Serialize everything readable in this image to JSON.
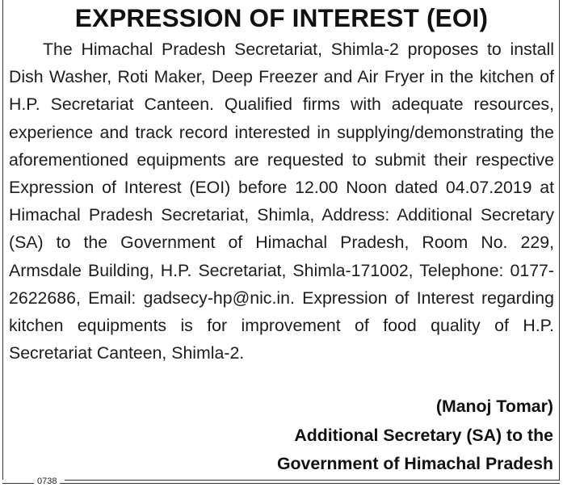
{
  "notice": {
    "title": "EXPRESSION OF INTEREST (EOI)",
    "body": "The Himachal Pradesh Secretariat, Shimla-2 proposes to install Dish Washer, Roti Maker, Deep Freezer and Air Fryer in the kitchen of H.P. Secretariat Canteen. Qualified firms with adequate resources, experience and track record interested in supplying/demonstrating the aforementioned equipments are requested to submit their respective Expression of Interest (EOI) before 12.00 Noon dated 04.07.2019 at Himachal Pradesh Secretariat, Shimla, Address: Additional Secretary (SA) to the Government of Himachal Pradesh, Room No. 229, Armsdale Building, H.P. Secretariat, Shimla-171002, Telephone: 0177-2622686, Email: gadsecy-hp@nic.in. Expression of Interest regarding kitchen equipments is for improvement of food quality of H.P. Secretariat Canteen, Shimla-2.",
    "signatory_name": "(Manoj Tomar)",
    "designation_line1": "Additional Secretary (SA) to the",
    "designation_line2": "Government of Himachal Pradesh",
    "ad_code": "0738"
  }
}
